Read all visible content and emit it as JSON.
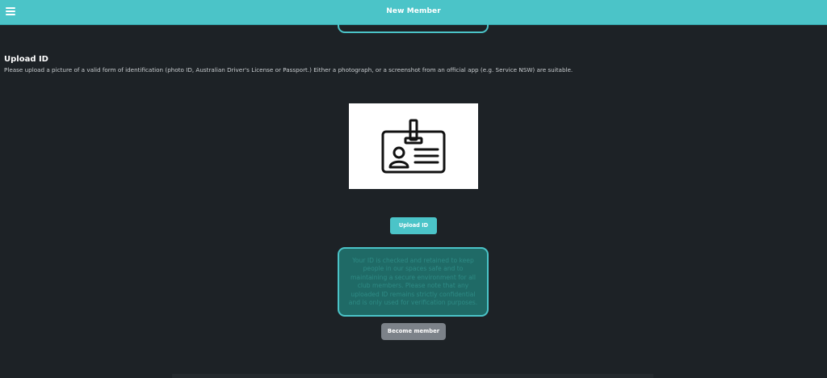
{
  "header": {
    "title": "New Member",
    "menu_icon": "hamburger-menu-icon",
    "background_color": "#4bc4c8"
  },
  "upload_section": {
    "title": "Upload ID",
    "description": "Please upload a picture of a valid form of identification (photo ID, Australian Driver's License or Passport.) Either a photograph, or a screenshot from an official app (e.g. Service NSW) are suitable.",
    "image_icon": "id-card-icon",
    "upload_button_label": "Upload ID"
  },
  "notice": {
    "text": "Your ID is checked and retained to keep people in our spaces safe and to maintaining a secure environment for all club members. Please note that any uploaded ID remains strictly confidential and is only used for verification purposes."
  },
  "footer": {
    "become_member_label": "Become member"
  },
  "colors": {
    "accent": "#4bc4c8",
    "background": "#1d2226",
    "disabled_button": "#7c8289",
    "notice_fill": "#1f6a66"
  }
}
